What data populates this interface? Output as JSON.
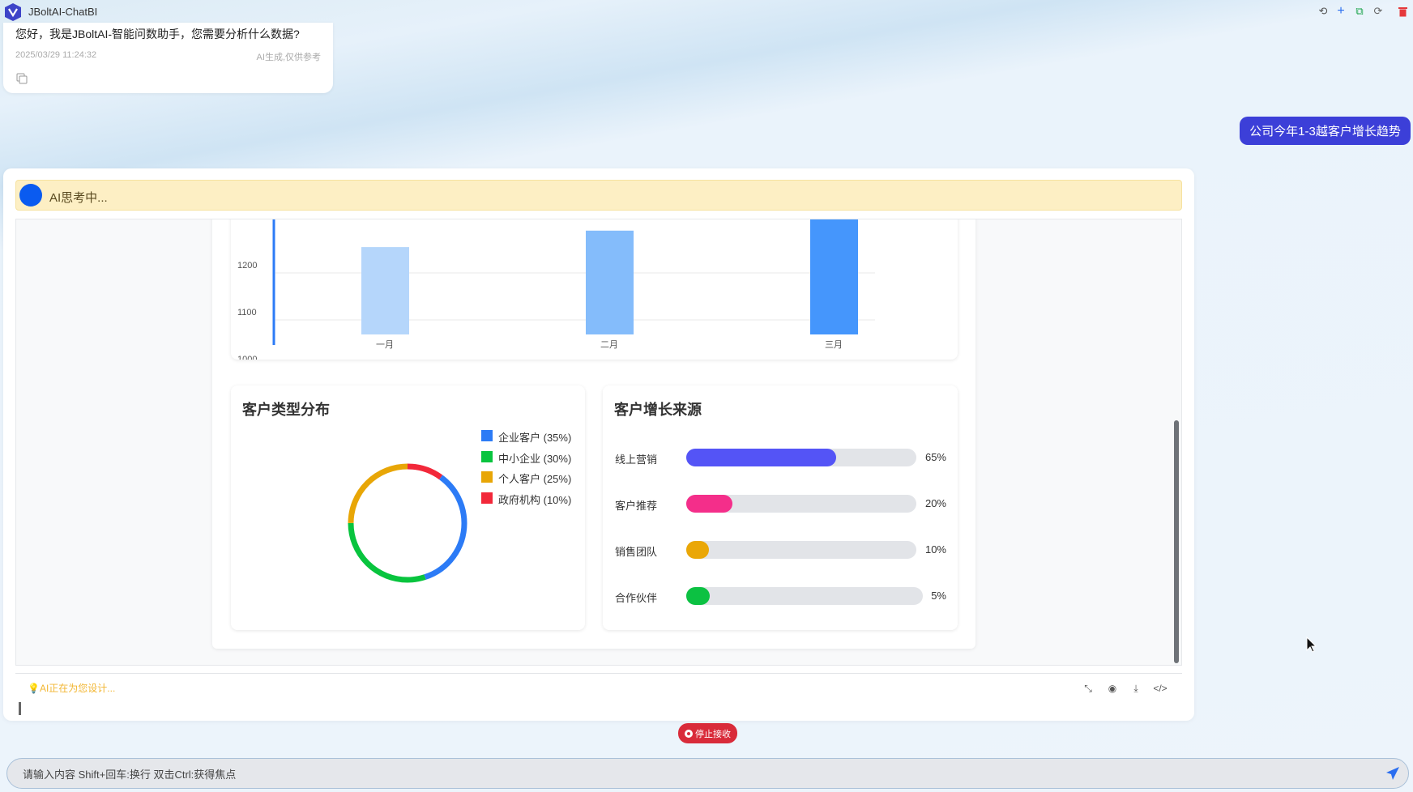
{
  "app": {
    "title": "JBoltAI-ChatBI"
  },
  "titlebar_icons": [
    "history-icon",
    "plus-icon",
    "external-link-icon",
    "refresh-icon",
    "trash-icon"
  ],
  "welcome": {
    "text": "您好，我是JBoltAI-智能问数助手，您需要分析什么数据?",
    "time": "2025/03/29 11:24:32",
    "note": "AI生成,仅供参考"
  },
  "user_message": "公司今年1-3越客户增长趋势",
  "thinking": {
    "text": "AI思考中..."
  },
  "chart_data": [
    {
      "type": "bar",
      "title": "",
      "categories": [
        "一月",
        "二月",
        "三月"
      ],
      "values": [
        1255,
        1290,
        1320
      ],
      "yticks": [
        "1000",
        "1100",
        "1200"
      ],
      "ylim": [
        1000,
        1300
      ],
      "colors": [
        "#b5d6fb",
        "#84bcfb",
        "#4596fc"
      ]
    },
    {
      "type": "pie",
      "title": "客户类型分布",
      "slices": [
        {
          "label": "企业客户 (35%)",
          "value": 35,
          "color": "#2c7bf6"
        },
        {
          "label": "中小企业 (30%)",
          "value": 30,
          "color": "#08c43e"
        },
        {
          "label": "个人客户 (25%)",
          "value": 25,
          "color": "#e8a606"
        },
        {
          "label": "政府机构 (10%)",
          "value": 10,
          "color": "#f2283a"
        }
      ]
    },
    {
      "type": "bar",
      "title": "客户增长来源",
      "rows": [
        {
          "label": "线上营销",
          "value": 65,
          "pct": "65%",
          "color": "#5454f6"
        },
        {
          "label": "客户推荐",
          "value": 20,
          "pct": "20%",
          "color": "#f42e8a"
        },
        {
          "label": "销售团队",
          "value": 10,
          "pct": "10%",
          "color": "#eaa707"
        },
        {
          "label": "合作伙伴",
          "value": 5,
          "pct": "5%",
          "color": "#0cc142"
        }
      ]
    }
  ],
  "footer": {
    "designing": "AI正在为您设计...",
    "stop": "停止接收"
  },
  "input": {
    "placeholder": "请输入内容 Shift+回车:换行 双击Ctrl:获得焦点"
  }
}
